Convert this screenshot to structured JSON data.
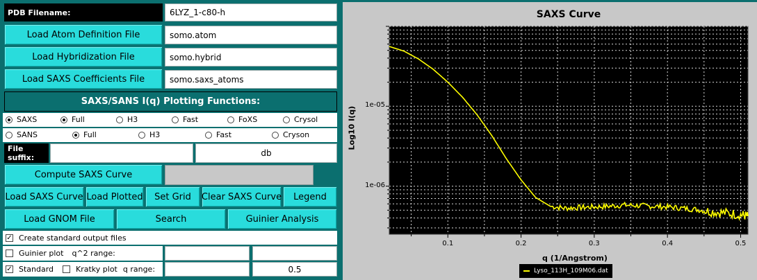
{
  "pdb": {
    "label": "PDB Filename:",
    "value": "6LYZ_1-c80-h"
  },
  "files": [
    {
      "button": "Load Atom Definition File",
      "value": "somo.atom"
    },
    {
      "button": "Load Hybridization File",
      "value": "somo.hybrid"
    },
    {
      "button": "Load SAXS Coefficients File",
      "value": "somo.saxs_atoms"
    }
  ],
  "section_title": "SAXS/SANS I(q) Plotting Functions:",
  "saxs_row": [
    "SAXS",
    "Full",
    "H3",
    "Fast",
    "FoXS",
    "Crysol"
  ],
  "sans_row": [
    "SANS",
    "Full",
    "H3",
    "Fast",
    "Cryson"
  ],
  "suffix": {
    "label": "File suffix:",
    "value": "",
    "value2": "db"
  },
  "compute_label": "Compute SAXS Curve",
  "actions": [
    "Load SAXS Curve",
    "Load Plotted",
    "Set Grid",
    "Clear SAXS Curve",
    "Legend"
  ],
  "actions2": [
    "Load GNOM File",
    "Search",
    "Guinier Analysis"
  ],
  "opt_create": "Create standard output files",
  "guinier": {
    "label": "Guinier plot",
    "range_label": "q^2 range:",
    "from": "",
    "to": ""
  },
  "kratky": {
    "standard_label": "Standard",
    "label": "Kratky plot",
    "range_label": "q range:",
    "from": "",
    "to": "0.5"
  },
  "chart_data": {
    "type": "line",
    "title": "SAXS Curve",
    "xlabel": "q (1/Angstrom)",
    "ylabel": "Log10 I(q)",
    "x_ticks": [
      "0.1",
      "0.2",
      "0.3",
      "0.4",
      "0.5"
    ],
    "y_ticks": [
      "1e-05",
      "1e-06"
    ],
    "xlim": [
      0.02,
      0.51
    ],
    "ylim": [
      2.5e-07,
      0.0001
    ],
    "y_scale": "log",
    "grid": true,
    "background": "#000000",
    "line_color": "#ffff00",
    "legend_position": "bottom",
    "series": [
      {
        "name": "Lyso_113H_109M06.dat",
        "x": [
          0.02,
          0.04,
          0.06,
          0.08,
          0.1,
          0.12,
          0.14,
          0.16,
          0.18,
          0.2,
          0.22,
          0.24,
          0.26,
          0.28,
          0.3,
          0.32,
          0.34,
          0.36,
          0.38,
          0.4,
          0.42,
          0.44,
          0.46,
          0.48,
          0.5,
          0.51
        ],
        "y": [
          5.6e-05,
          4.9e-05,
          3.9e-05,
          2.9e-05,
          2e-05,
          1.3e-05,
          7.8e-06,
          4.3e-06,
          2.2e-06,
          1.2e-06,
          7.2e-07,
          5.6e-07,
          5.3e-07,
          5.4e-07,
          5.5e-07,
          5.6e-07,
          5.8e-07,
          5.7e-07,
          5.6e-07,
          5.5e-07,
          5.3e-07,
          5.1e-07,
          4.8e-07,
          4.6e-07,
          4.4e-07,
          4.2e-07
        ]
      }
    ]
  }
}
